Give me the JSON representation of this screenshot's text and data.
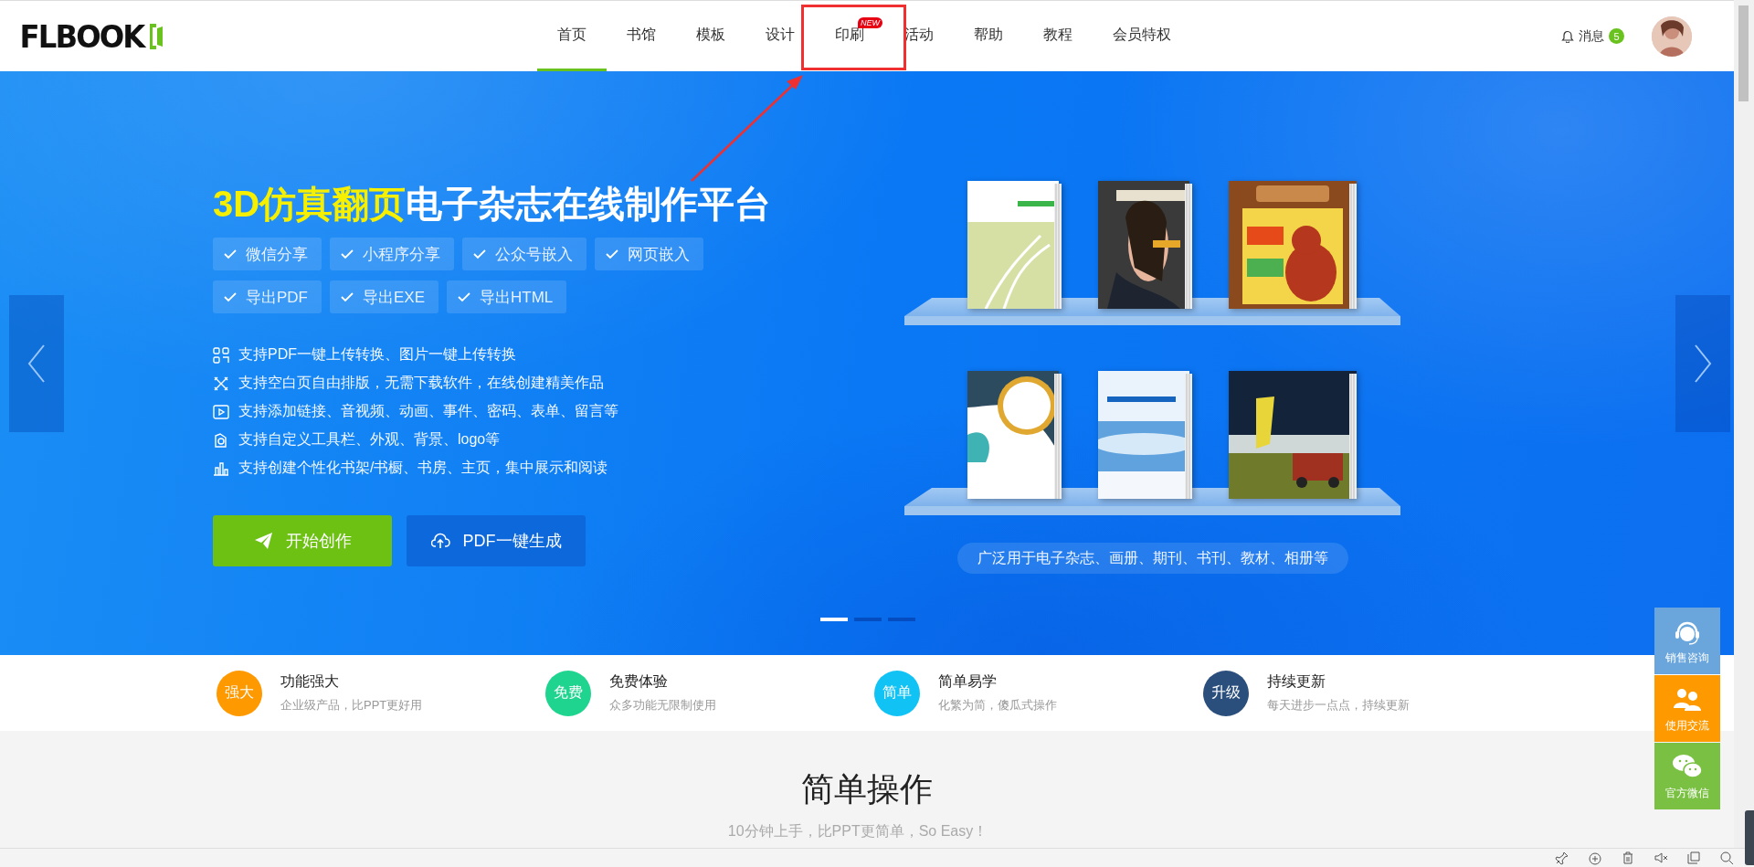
{
  "header": {
    "logo": "FLBOOK",
    "nav": [
      {
        "label": "首页",
        "selected": true
      },
      {
        "label": "书馆",
        "selected": false
      },
      {
        "label": "模板",
        "selected": false
      },
      {
        "label": "设计",
        "selected": false
      },
      {
        "label": "印刷",
        "selected": false,
        "badge": "NEW"
      },
      {
        "label": "活动",
        "selected": false
      },
      {
        "label": "帮助",
        "selected": false
      },
      {
        "label": "教程",
        "selected": false
      },
      {
        "label": "会员特权",
        "selected": false
      }
    ],
    "messages": {
      "label": "消息",
      "count": "5"
    }
  },
  "hero": {
    "title_highlight": "3D仿真翻页",
    "title": "电子杂志在线制作平台",
    "tag_rows": [
      [
        "微信分享",
        "小程序分享",
        "公众号嵌入",
        "网页嵌入"
      ],
      [
        "导出PDF",
        "导出EXE",
        "导出HTML"
      ]
    ],
    "features": [
      "支持PDF一键上传转换、图片一键上传转换",
      "支持空白页自由排版，无需下载软件，在线创建精美作品",
      "支持添加链接、音视频、动画、事件、密码、表单、留言等",
      "支持自定义工具栏、外观、背景、logo等",
      "支持创建个性化书架/书橱、书房、主页，集中展示和阅读"
    ],
    "buttons": [
      {
        "label": "开始创作",
        "kind": "primary"
      },
      {
        "label": "PDF一键生成",
        "kind": "secondary"
      }
    ],
    "caption": "广泛用于电子杂志、画册、期刊、书刊、教材、相册等",
    "dots": [
      {
        "selected": true
      },
      {
        "selected": false
      },
      {
        "selected": false
      }
    ]
  },
  "strip": [
    {
      "badge": "强大",
      "color": "#ff9900",
      "title": "功能强大",
      "desc": "企业级产品，比PPT更好用"
    },
    {
      "badge": "免费",
      "color": "#1fd48e",
      "title": "免费体验",
      "desc": "众多功能无限制使用"
    },
    {
      "badge": "简单",
      "color": "#11c2f5",
      "title": "简单易学",
      "desc": "化繁为简，傻瓜式操作"
    },
    {
      "badge": "升级",
      "color": "#2b4f7c",
      "title": "持续更新",
      "desc": "每天进步一点点，持续更新"
    }
  ],
  "section": {
    "title": "简单操作",
    "subtitle": "10分钟上手，比PPT更简单，So Easy！"
  },
  "side_widgets": [
    {
      "label": "销售咨询",
      "color": "#6aa6dc"
    },
    {
      "label": "使用交流",
      "color": "#ff9900"
    },
    {
      "label": "官方微信",
      "color": "#7ac143"
    }
  ]
}
